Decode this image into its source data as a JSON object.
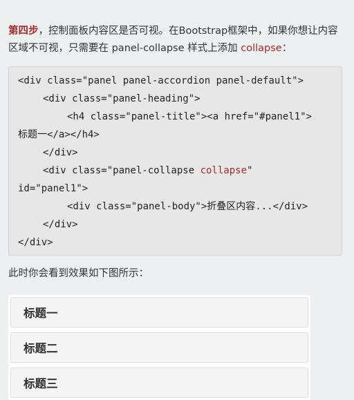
{
  "intro": {
    "step_label": "第四步",
    "text_before": "，控制面板内容区是否可视。在Bootstrap框架中，如果你想让内容区域不可视，只需要在 panel-collapse 样式上添加 ",
    "keyword": "collapse",
    "text_after": "："
  },
  "code": {
    "line1": "<div class=\"panel panel-accordion panel-default\">",
    "line2": "<div class=\"panel-heading\">",
    "line3": "<h4 class=\"panel-title\"><a href=\"#panel1\">",
    "line4": "标题一</a></h4>",
    "line5": "</div>",
    "line6_before": "<div class=\"panel-collapse ",
    "line6_keyword": "collapse",
    "line6_after": "\"",
    "line7": "id=\"panel1\">",
    "line8": "<div class=\"panel-body\">折叠区内容...</div>",
    "line9": "</div>",
    "line10": "</div>"
  },
  "after_text": "此时你会看到效果如下图所示：",
  "accordion": {
    "panels": [
      {
        "title": "标题一"
      },
      {
        "title": "标题二"
      },
      {
        "title": "标题三"
      }
    ]
  },
  "colors": {
    "background": "#ecf0f1",
    "accent_red": "#a52a2a",
    "code_background": "#e7e7e7",
    "panel_heading": "#f5f5f5"
  }
}
